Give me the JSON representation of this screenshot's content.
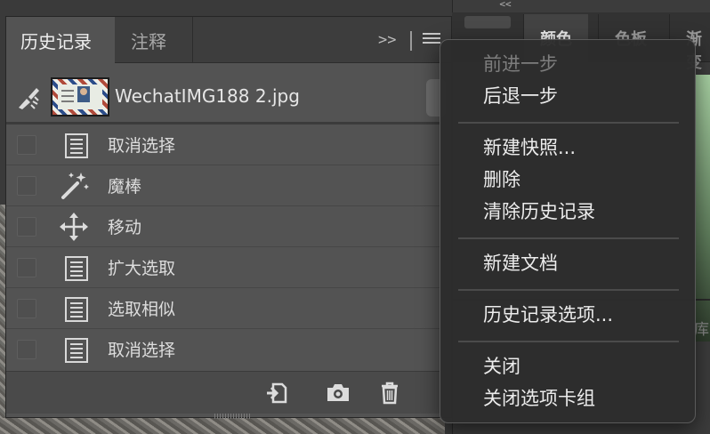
{
  "dock": {
    "collapse_label": "<<",
    "tabs": [
      "颜色",
      "色板",
      "渐变"
    ],
    "side_text": "库"
  },
  "history_panel": {
    "tabs": [
      {
        "label": "历史记录",
        "active": true
      },
      {
        "label": "注释",
        "active": false
      }
    ],
    "overflow_label": ">>",
    "snapshot": {
      "label": "WechatIMG188 2.jpg",
      "icon": "history-brush-icon"
    },
    "states": [
      {
        "label": "取消选择",
        "icon": "document-icon"
      },
      {
        "label": "魔棒",
        "icon": "magic-wand-icon"
      },
      {
        "label": "移动",
        "icon": "move-icon"
      },
      {
        "label": "扩大选取",
        "icon": "document-icon"
      },
      {
        "label": "选取相似",
        "icon": "document-icon"
      },
      {
        "label": "取消选择",
        "icon": "document-icon"
      }
    ],
    "footer_icons": [
      "new-document-from-state-icon",
      "camera-icon",
      "trash-icon"
    ]
  },
  "context_menu": {
    "groups": [
      [
        {
          "label": "前进一步",
          "enabled": false
        },
        {
          "label": "后退一步",
          "enabled": true
        }
      ],
      [
        {
          "label": "新建快照...",
          "enabled": true
        },
        {
          "label": "删除",
          "enabled": true
        },
        {
          "label": "清除历史记录",
          "enabled": true
        }
      ],
      [
        {
          "label": "新建文档",
          "enabled": true
        }
      ],
      [
        {
          "label": "历史记录选项...",
          "enabled": true
        }
      ],
      [
        {
          "label": "关闭",
          "enabled": true
        },
        {
          "label": "关闭选项卡组",
          "enabled": true
        }
      ]
    ]
  }
}
